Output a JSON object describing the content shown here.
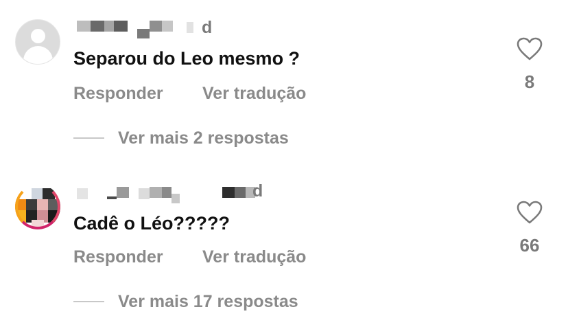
{
  "comments": [
    {
      "time_fragment": "d",
      "text": "Separou do Leo mesmo ?",
      "reply_label": "Responder",
      "translate_label": "Ver tradução",
      "more_replies": "Ver mais 2 respostas",
      "likes": "8"
    },
    {
      "time_fragment": "d",
      "text": "Cadê o Léo?????",
      "reply_label": "Responder",
      "translate_label": "Ver tradução",
      "more_replies": "Ver mais 17 respostas",
      "likes": "66"
    }
  ],
  "colors": {
    "text": "#111111",
    "muted": "#8a8a8a",
    "avatar_ring_start": "#f6a21b",
    "avatar_ring_end": "#d1246a"
  },
  "icons": {
    "like": "heart-outline-icon",
    "avatar_default": "default-avatar-icon"
  }
}
